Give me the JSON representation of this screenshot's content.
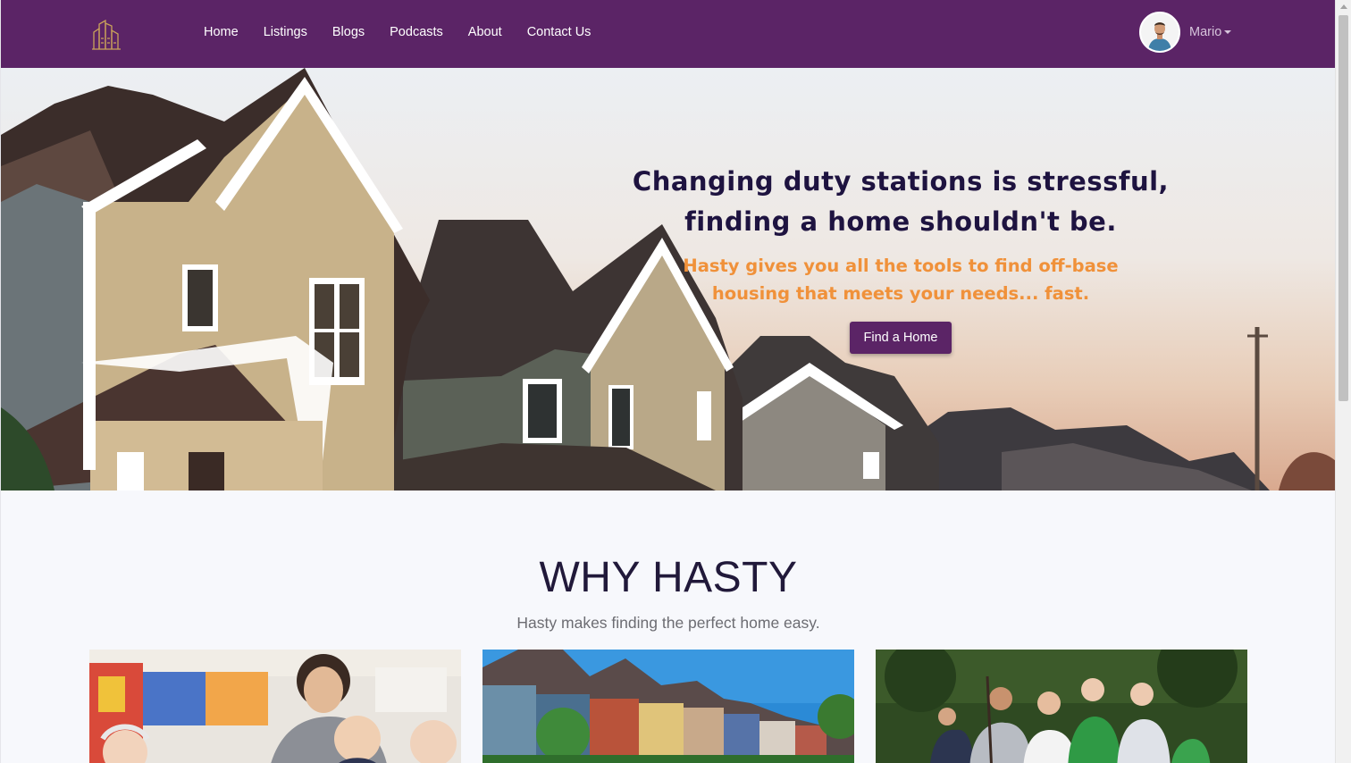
{
  "nav": {
    "links": [
      "Home",
      "Listings",
      "Blogs",
      "Podcasts",
      "About",
      "Contact Us"
    ],
    "user_name": "Mario"
  },
  "hero": {
    "title_line1": "Changing duty stations is stressful,",
    "title_line2": "finding a home shouldn't be.",
    "subtitle_line1": "Hasty gives you all the tools to find off-base",
    "subtitle_line2": "housing that meets your needs... fast.",
    "cta_label": "Find a Home"
  },
  "why": {
    "title": "WHY HASTY",
    "subtitle": "Hasty makes finding the perfect home easy."
  },
  "colors": {
    "brand_purple": "#5b2466",
    "accent_orange": "#f0913a",
    "heading_dark": "#1e1340"
  }
}
